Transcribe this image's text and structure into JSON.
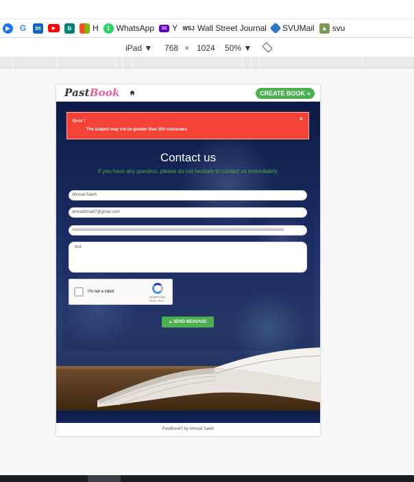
{
  "bookmarks": [
    {
      "label": "",
      "icon": "chrome-apps-icon",
      "color": "#1a73e8"
    },
    {
      "label": "",
      "icon": "google-icon",
      "color": "#ffffff"
    },
    {
      "label": "",
      "icon": "linkedin-icon",
      "color": "#0a66c2"
    },
    {
      "label": "",
      "icon": "youtube-icon",
      "color": "#ff0000"
    },
    {
      "label": "",
      "icon": "bing-icon",
      "color": "#008373"
    },
    {
      "label": "H",
      "icon": "microsoft-icon",
      "color": "#f25022"
    },
    {
      "label": "WhatsApp",
      "icon": "whatsapp-icon",
      "color": "#25d366"
    },
    {
      "label": "Y",
      "icon": "yahoo-mail-icon",
      "color": "#6001d2"
    },
    {
      "label": "Wall Street Journal",
      "icon": "wsj-icon",
      "color": "#222222"
    },
    {
      "label": "SVUMail",
      "icon": "svumail-icon",
      "color": "#2b78c5"
    },
    {
      "label": "svu",
      "icon": "svu-icon",
      "color": "#7a9a5a"
    }
  ],
  "device_bar": {
    "device": "iPad",
    "width": "768",
    "times": "×",
    "height": "1024",
    "zoom": "50%"
  },
  "navbar": {
    "logo_part1": "Past",
    "logo_part2": "Book",
    "create_button": "CREATE BOOK"
  },
  "alert": {
    "title": "Error !",
    "message": "The subject may not be greater than 254 characters.",
    "close": "×"
  },
  "contact": {
    "title": "Contact us",
    "subtitle": "If you have any question, please do not hesitate to contact us immediately."
  },
  "form": {
    "name_value": "Ahmad Saleh",
    "email_value": "ahmadmsa87@gmail.com",
    "subject_value": "sssssssssssssssssssssssssssssssssssssssssssssssssssssssssssssssssssssssssssssssssssssssssssssssssssssss",
    "message_value": "test",
    "captcha_label": "I'm not a robot",
    "captcha_brand": "reCAPTCHA",
    "captcha_terms": "Privacy - Terms",
    "send_button": "SEND MESSAGE"
  },
  "footer": {
    "text": "PastBook© by Ahmad Saleh"
  }
}
